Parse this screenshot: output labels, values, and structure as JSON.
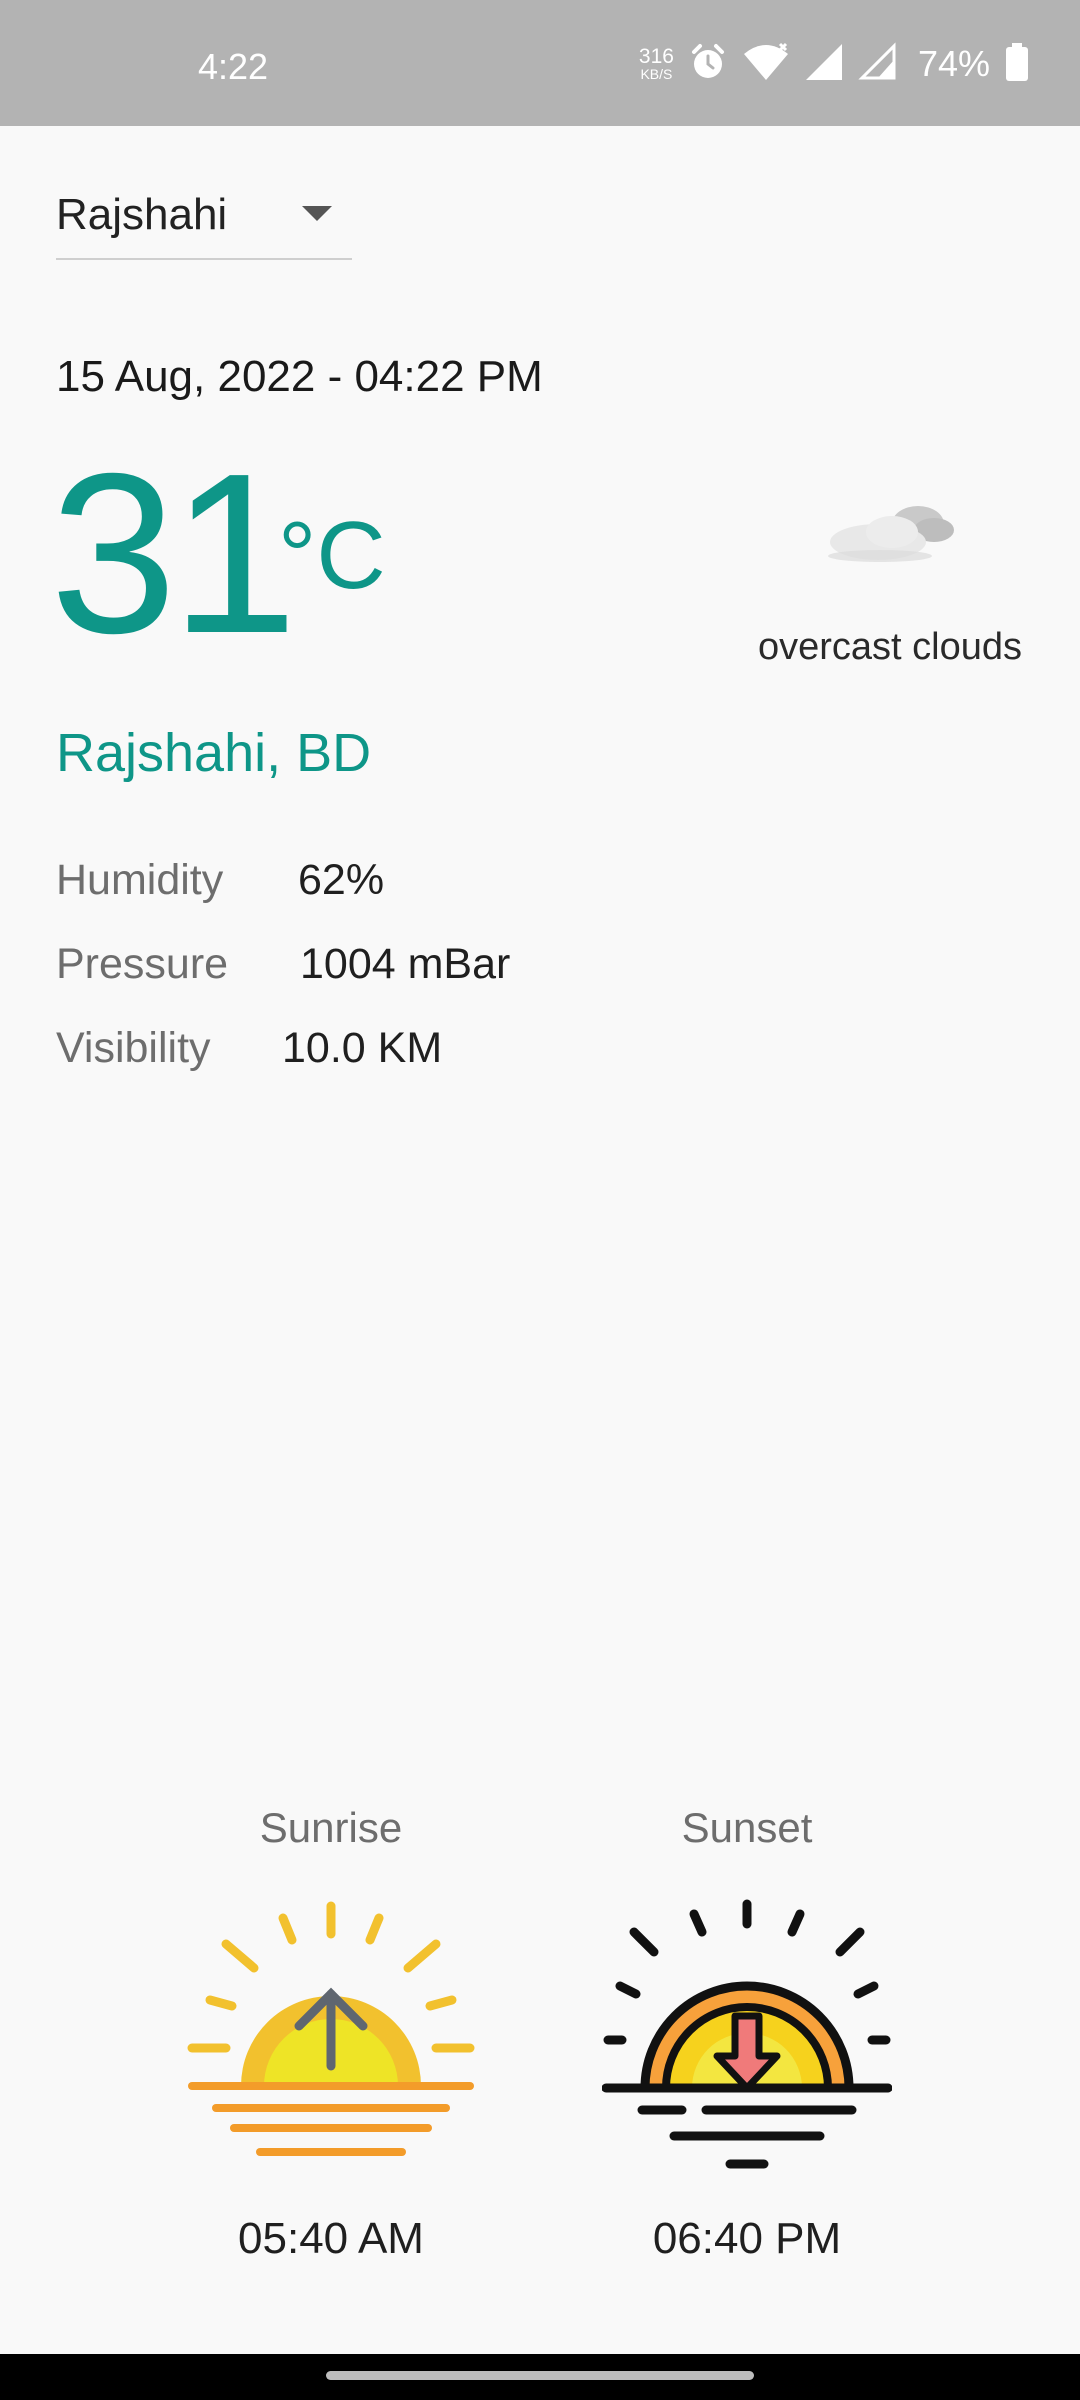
{
  "status_bar": {
    "time": "4:22",
    "net_speed_value": "316",
    "net_speed_unit": "KB/S",
    "battery": "74%",
    "icons": [
      "alarm-icon",
      "wifi-icon",
      "cellular-signal-icon",
      "cellular-signal-icon",
      "battery-icon"
    ]
  },
  "city_dropdown": {
    "selected": "Rajshahi"
  },
  "weather": {
    "datetime": "15 Aug, 2022 - 04:22 PM",
    "temperature": "31",
    "unit": "°C",
    "description": "overcast clouds",
    "location": "Rajshahi, BD",
    "icon": "overcast-clouds-icon"
  },
  "details": [
    {
      "label": "Humidity",
      "value": "62%"
    },
    {
      "label": "Pressure",
      "value": "1004 mBar"
    },
    {
      "label": "Visibility",
      "value": "10.0 KM"
    }
  ],
  "sun": {
    "sunrise_label": "Sunrise",
    "sunrise_time": "05:40 AM",
    "sunset_label": "Sunset",
    "sunset_time": "06:40 PM"
  },
  "colors": {
    "accent": "#0e9688",
    "status_bar": "#b3b3b3",
    "background": "#f9f9f9"
  }
}
